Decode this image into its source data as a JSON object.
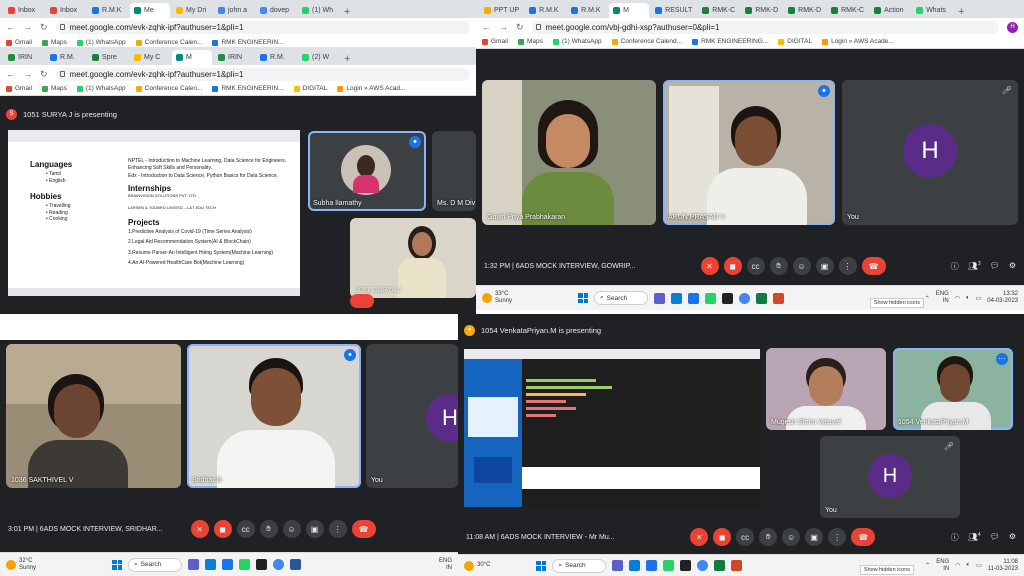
{
  "q1": {
    "tabs": [
      "Inbox",
      "Inbox",
      "R.M.K",
      "Me",
      "My Dri",
      "john a",
      "dovep",
      "(1) Wh"
    ],
    "url": "meet.google.com/evk-zqhk-ipf?authuser=1&pli=1",
    "tabs2": [
      "IRIN",
      "R.M.",
      "Spre",
      "My C",
      "M",
      "IRIN",
      "R.M.",
      "(2) W"
    ],
    "url2": "meet.google.com/evk-zqhk-ipf?authuser=1&pli=1",
    "bookmarks": [
      "Gmail",
      "Maps",
      "(1) WhatsApp",
      "Conference Calen...",
      "RMK ENGINEERIN...",
      "DIGITAL",
      "Login » AWS Acad..."
    ],
    "presenting": "1051 SURYA J is presenting",
    "presenter_initial": "S",
    "doc": {
      "lang_head": "Languages",
      "langs": [
        "Tamil",
        "English"
      ],
      "hob_head": "Hobbies",
      "hobbies": [
        "Travelling",
        "Reading",
        "Cooking"
      ],
      "nptel": "NPTEL - Introduction to Machine Learning, Data Science for Engineers, Enhancing Soft Skills and Personality.",
      "edx": "Edx - Introduction to Data Science, Python Basics for Data Science.",
      "intern_head": "Internships",
      "intern1": "BRAINVISION SOLUTIONS PVT. LTD",
      "intern2": "LARSEN & TOUBRO LIMITED – L&T EDU TECH",
      "proj_head": "Projects",
      "projects": [
        "1.Predictive Analysis of Covid-19 (Time Series Analysis)",
        "2.Legal Aid Recommendation System(AI & BlockChain)",
        "3.Resume Parser-An Intelligent Hiring System(Machine Learning)",
        "4.An AI-Powered HealthCare Bot(Machine Learning)"
      ]
    },
    "tiles": [
      "Subha Ilamathy",
      "Ms. D M Div",
      "1051 SURYA J"
    ]
  },
  "q2": {
    "tabs": [
      "PPT UP",
      "R.M.K",
      "R.M.K",
      "M",
      "RESULT",
      "RMK-C",
      "RMK-D",
      "RMK-D",
      "RMK-C",
      "Action",
      "Whats"
    ],
    "url": "meet.google.com/vbj-gdhi-xsp?authuser=0&pli=1",
    "bookmarks": [
      "Gmail",
      "Maps",
      "(1) WhatsApp",
      "Conference Calend...",
      "RMK ENGINEERING...",
      "DIGITAL",
      "Login » AWS Acade..."
    ],
    "tiles": [
      "Gowri Priya Prabhakaran",
      "ARUN PRASAD V",
      "You"
    ],
    "avatar": "H",
    "time": "1:32 PM",
    "meeting": "6ADS MOCK INTERVIEW, GOWRIP...",
    "people_count": "3",
    "weather_temp": "33°C",
    "weather_desc": "Sunny",
    "search": "Search",
    "tooltip": "Show hidden icons",
    "lang": "ENG",
    "lang2": "IN",
    "clock_time": "13:32",
    "clock_date": "04-03-2023"
  },
  "q3": {
    "tiles": [
      "1036 SAKTHIVEL V",
      "Sridhar G",
      "You"
    ],
    "avatar": "H",
    "time": "3:01 PM",
    "meeting": "6ADS MOCK INTERVIEW, SRIDHAR...",
    "weather_temp": "32°C",
    "weather_desc": "Sunny",
    "search": "Search",
    "lang": "ENG",
    "lang2": "IN"
  },
  "q4": {
    "presenting": "1054 VenkataPriyan.M is presenting",
    "tiles": [
      "Mugesh Shrim Velavel",
      "1054 VenkataPriyan.M",
      "You"
    ],
    "avatar": "H",
    "time": "11:08 AM",
    "meeting": "6ADS MOCK INTERVIEW - Mr Mu...",
    "people_count": "4",
    "weather_temp": "30°C",
    "search": "Search",
    "tooltip": "Show hidden icons",
    "lang": "ENG",
    "lang2": "IN",
    "clock_time": "11:08",
    "clock_date": "11-03-2023"
  },
  "colors": {
    "meet_bg": "#202124",
    "tile_bg": "#3c4043",
    "avatar": "#5b2c87",
    "hangup": "#ea4335",
    "active_border": "#8ab4f8"
  }
}
